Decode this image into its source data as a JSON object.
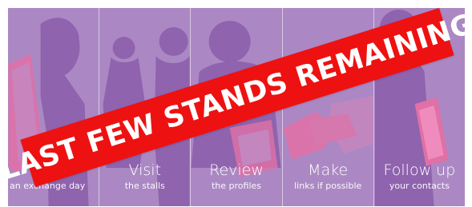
{
  "panels": [
    {
      "title": "",
      "subtitle": "an exchange day"
    },
    {
      "title": "Visit",
      "subtitle": "the stalls"
    },
    {
      "title": "Review",
      "subtitle": "the profiles"
    },
    {
      "title": "Make",
      "subtitle": "links if possible"
    },
    {
      "title": "Follow up",
      "subtitle": "your contacts"
    }
  ],
  "ribbon": {
    "text": "LAST FEW STANDS REMAINING"
  },
  "colors": {
    "panel_bg": "#ab88c4",
    "silhouette": "#8f63ad",
    "accent_pink": "#e070a6",
    "ribbon": "#ee1111",
    "text": "#ffffff"
  }
}
